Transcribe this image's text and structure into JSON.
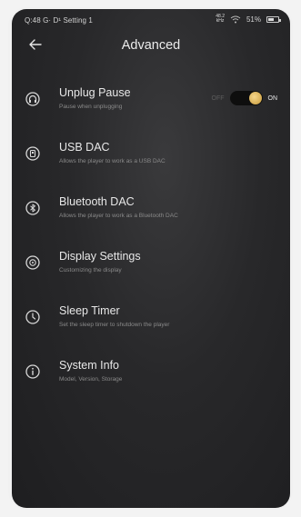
{
  "status_bar": {
    "left_text": "Q:48 G· D¹ Setting 1",
    "hires_line1": "48.2",
    "hires_line2": "kHz",
    "battery_text": "51%",
    "battery_level": 0.51
  },
  "header": {
    "title": "Advanced",
    "back_icon": "arrow-left-icon"
  },
  "items": [
    {
      "title": "Unplug Pause",
      "subtitle": "Pause when unplugging",
      "icon": "headphones-icon",
      "toggle": {
        "off_label": "OFF",
        "on_label": "ON",
        "state": "on"
      }
    },
    {
      "title": "USB DAC",
      "subtitle": "Allows the player to work as a USB DAC",
      "icon": "usb-dac-icon"
    },
    {
      "title": "Bluetooth DAC",
      "subtitle": "Allows the player to work as a Bluetooth DAC",
      "icon": "bluetooth-icon"
    },
    {
      "title": "Display Settings",
      "subtitle": "Customizing the display",
      "icon": "display-icon"
    },
    {
      "title": "Sleep Timer",
      "subtitle": "Set the sleep timer to shutdown the player",
      "icon": "clock-icon"
    },
    {
      "title": "System Info",
      "subtitle": "Model, Version, Storage",
      "icon": "info-icon"
    }
  ]
}
